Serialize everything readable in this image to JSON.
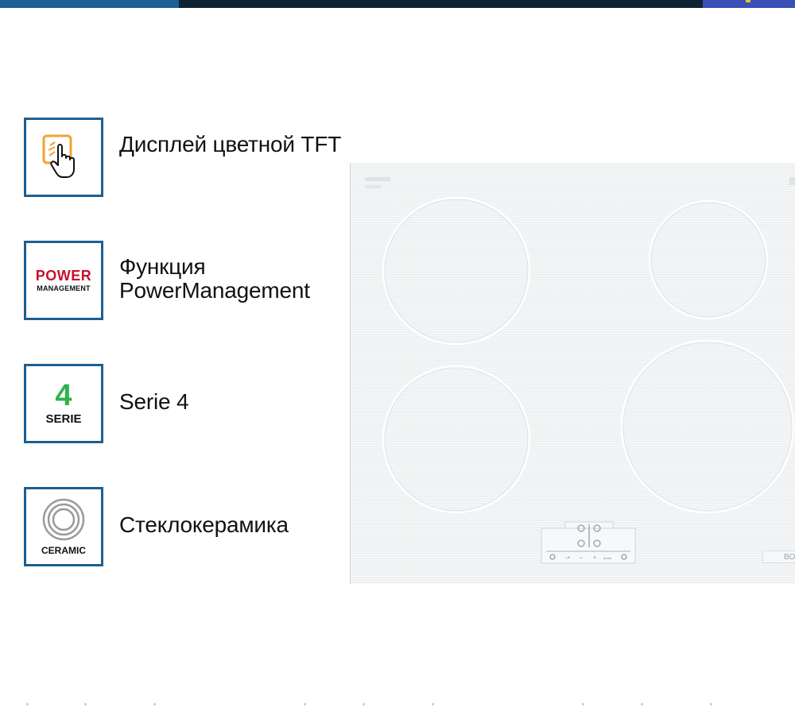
{
  "features": [
    {
      "icon": "touch-display-icon",
      "label": "Дисплей цветной TFT"
    },
    {
      "icon": "power-management-icon",
      "badge_top": "POWER",
      "badge_bottom": "MANAGEMENT",
      "label": "Функция PowerManagement"
    },
    {
      "icon": "serie-4-icon",
      "badge_top": "4",
      "badge_bottom": "SERIE",
      "label": "Serie 4"
    },
    {
      "icon": "ceramic-icon",
      "badge_bottom": "CERAMIC",
      "label": "Стеклокерамика"
    }
  ],
  "hob": {
    "brand": "BOS",
    "controls": {
      "plus": "+",
      "minus": "–",
      "boost": "boost"
    }
  },
  "colors": {
    "frame": "#1b5f93",
    "power_red": "#c8102e",
    "serie_green": "#2db34a",
    "touch_orange": "#f2a32b",
    "hob_surface": "#eef0f1"
  }
}
